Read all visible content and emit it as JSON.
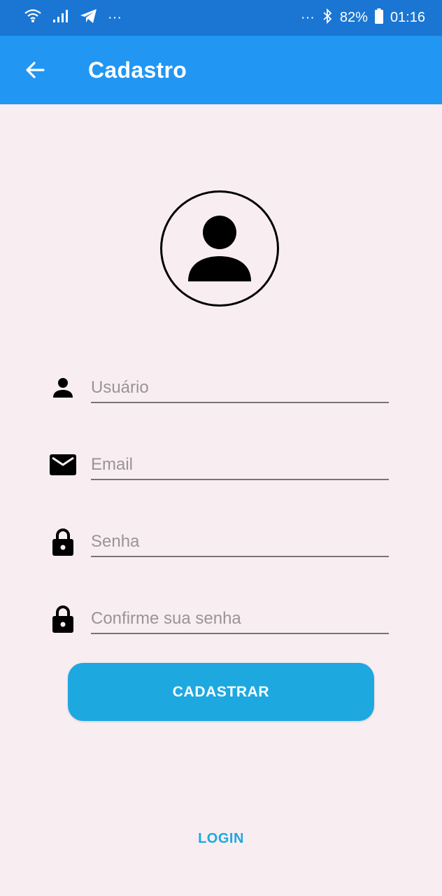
{
  "status_bar": {
    "more_left": "···",
    "more_right": "···",
    "battery": "82%",
    "time": "01:16"
  },
  "app_bar": {
    "title": "Cadastro"
  },
  "form": {
    "username_placeholder": "Usuário",
    "email_placeholder": "Email",
    "password_placeholder": "Senha",
    "confirm_password_placeholder": "Confirme sua senha"
  },
  "actions": {
    "register_label": "CADASTRAR",
    "login_label": "LOGIN"
  },
  "colors": {
    "status_bar": "#1a76d2",
    "app_bar": "#2196f3",
    "background": "#f8eef2",
    "accent": "#1ea8e0"
  }
}
